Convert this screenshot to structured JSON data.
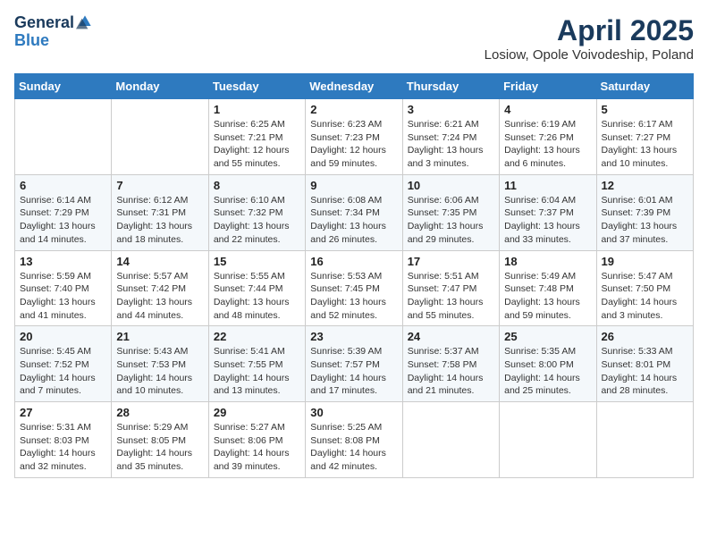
{
  "header": {
    "logo_general": "General",
    "logo_blue": "Blue",
    "month_title": "April 2025",
    "location": "Losiow, Opole Voivodeship, Poland"
  },
  "weekdays": [
    "Sunday",
    "Monday",
    "Tuesday",
    "Wednesday",
    "Thursday",
    "Friday",
    "Saturday"
  ],
  "weeks": [
    [
      {
        "day": "",
        "info": ""
      },
      {
        "day": "",
        "info": ""
      },
      {
        "day": "1",
        "info": "Sunrise: 6:25 AM\nSunset: 7:21 PM\nDaylight: 12 hours and 55 minutes."
      },
      {
        "day": "2",
        "info": "Sunrise: 6:23 AM\nSunset: 7:23 PM\nDaylight: 12 hours and 59 minutes."
      },
      {
        "day": "3",
        "info": "Sunrise: 6:21 AM\nSunset: 7:24 PM\nDaylight: 13 hours and 3 minutes."
      },
      {
        "day": "4",
        "info": "Sunrise: 6:19 AM\nSunset: 7:26 PM\nDaylight: 13 hours and 6 minutes."
      },
      {
        "day": "5",
        "info": "Sunrise: 6:17 AM\nSunset: 7:27 PM\nDaylight: 13 hours and 10 minutes."
      }
    ],
    [
      {
        "day": "6",
        "info": "Sunrise: 6:14 AM\nSunset: 7:29 PM\nDaylight: 13 hours and 14 minutes."
      },
      {
        "day": "7",
        "info": "Sunrise: 6:12 AM\nSunset: 7:31 PM\nDaylight: 13 hours and 18 minutes."
      },
      {
        "day": "8",
        "info": "Sunrise: 6:10 AM\nSunset: 7:32 PM\nDaylight: 13 hours and 22 minutes."
      },
      {
        "day": "9",
        "info": "Sunrise: 6:08 AM\nSunset: 7:34 PM\nDaylight: 13 hours and 26 minutes."
      },
      {
        "day": "10",
        "info": "Sunrise: 6:06 AM\nSunset: 7:35 PM\nDaylight: 13 hours and 29 minutes."
      },
      {
        "day": "11",
        "info": "Sunrise: 6:04 AM\nSunset: 7:37 PM\nDaylight: 13 hours and 33 minutes."
      },
      {
        "day": "12",
        "info": "Sunrise: 6:01 AM\nSunset: 7:39 PM\nDaylight: 13 hours and 37 minutes."
      }
    ],
    [
      {
        "day": "13",
        "info": "Sunrise: 5:59 AM\nSunset: 7:40 PM\nDaylight: 13 hours and 41 minutes."
      },
      {
        "day": "14",
        "info": "Sunrise: 5:57 AM\nSunset: 7:42 PM\nDaylight: 13 hours and 44 minutes."
      },
      {
        "day": "15",
        "info": "Sunrise: 5:55 AM\nSunset: 7:44 PM\nDaylight: 13 hours and 48 minutes."
      },
      {
        "day": "16",
        "info": "Sunrise: 5:53 AM\nSunset: 7:45 PM\nDaylight: 13 hours and 52 minutes."
      },
      {
        "day": "17",
        "info": "Sunrise: 5:51 AM\nSunset: 7:47 PM\nDaylight: 13 hours and 55 minutes."
      },
      {
        "day": "18",
        "info": "Sunrise: 5:49 AM\nSunset: 7:48 PM\nDaylight: 13 hours and 59 minutes."
      },
      {
        "day": "19",
        "info": "Sunrise: 5:47 AM\nSunset: 7:50 PM\nDaylight: 14 hours and 3 minutes."
      }
    ],
    [
      {
        "day": "20",
        "info": "Sunrise: 5:45 AM\nSunset: 7:52 PM\nDaylight: 14 hours and 7 minutes."
      },
      {
        "day": "21",
        "info": "Sunrise: 5:43 AM\nSunset: 7:53 PM\nDaylight: 14 hours and 10 minutes."
      },
      {
        "day": "22",
        "info": "Sunrise: 5:41 AM\nSunset: 7:55 PM\nDaylight: 14 hours and 13 minutes."
      },
      {
        "day": "23",
        "info": "Sunrise: 5:39 AM\nSunset: 7:57 PM\nDaylight: 14 hours and 17 minutes."
      },
      {
        "day": "24",
        "info": "Sunrise: 5:37 AM\nSunset: 7:58 PM\nDaylight: 14 hours and 21 minutes."
      },
      {
        "day": "25",
        "info": "Sunrise: 5:35 AM\nSunset: 8:00 PM\nDaylight: 14 hours and 25 minutes."
      },
      {
        "day": "26",
        "info": "Sunrise: 5:33 AM\nSunset: 8:01 PM\nDaylight: 14 hours and 28 minutes."
      }
    ],
    [
      {
        "day": "27",
        "info": "Sunrise: 5:31 AM\nSunset: 8:03 PM\nDaylight: 14 hours and 32 minutes."
      },
      {
        "day": "28",
        "info": "Sunrise: 5:29 AM\nSunset: 8:05 PM\nDaylight: 14 hours and 35 minutes."
      },
      {
        "day": "29",
        "info": "Sunrise: 5:27 AM\nSunset: 8:06 PM\nDaylight: 14 hours and 39 minutes."
      },
      {
        "day": "30",
        "info": "Sunrise: 5:25 AM\nSunset: 8:08 PM\nDaylight: 14 hours and 42 minutes."
      },
      {
        "day": "",
        "info": ""
      },
      {
        "day": "",
        "info": ""
      },
      {
        "day": "",
        "info": ""
      }
    ]
  ]
}
